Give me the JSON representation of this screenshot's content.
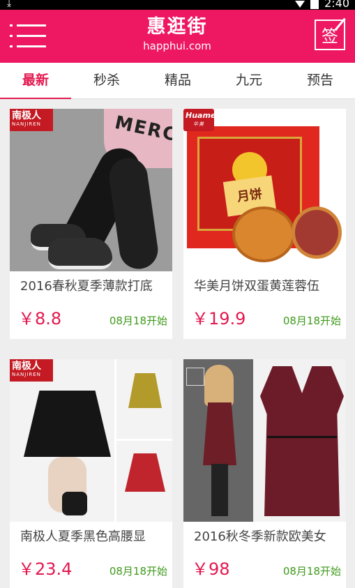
{
  "statusbar": {
    "time": "2:40"
  },
  "header": {
    "title": "惠逛街",
    "subtitle": "happhui.com",
    "signin_label": "签"
  },
  "tabs": [
    {
      "label": "最新",
      "active": true
    },
    {
      "label": "秒杀",
      "active": false
    },
    {
      "label": "精品",
      "active": false
    },
    {
      "label": "九元",
      "active": false
    },
    {
      "label": "预告",
      "active": false
    }
  ],
  "products": [
    {
      "name": "2016春秋夏季薄款打底",
      "price": "￥8.8",
      "start": "08月18开始",
      "badge": "南极人",
      "badge_sub": "NANJIREN"
    },
    {
      "name": "华美月饼双蛋黄莲蓉伍",
      "price": "￥19.9",
      "start": "08月18开始",
      "badge": "Huamei",
      "badge_sub": "华美",
      "package_text": "月饼"
    },
    {
      "name": "南极人夏季黑色高腰显",
      "price": "￥23.4",
      "start": "08月18开始",
      "badge": "南极人",
      "badge_sub": "NANJIREN"
    },
    {
      "name": "2016秋冬季新款欧美女",
      "price": "￥98",
      "start": "08月18开始"
    }
  ],
  "colors": {
    "brand": "#ee1762",
    "price": "#e3184f",
    "date": "#3f9a1b"
  },
  "icons": {
    "menu": "menu-icon",
    "signin": "signin-icon"
  }
}
